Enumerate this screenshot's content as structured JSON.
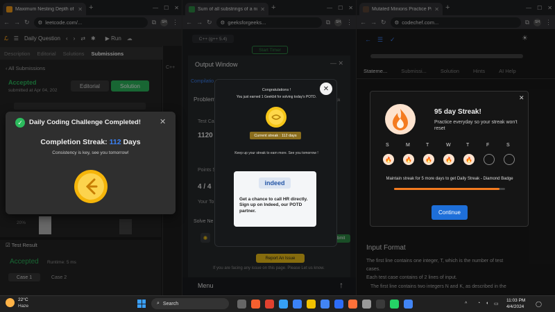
{
  "windows": {
    "leetcode": {
      "tab_title": "Maximum Nesting Depth of the",
      "url": "leetcode.com/...",
      "toolbar": {
        "title": "Daily Question",
        "run": "Run"
      },
      "tabs": [
        "Description",
        "Editorial",
        "Solutions",
        "Submissions"
      ],
      "all_submissions": "All Submissions",
      "status": "Accepted",
      "submitted": "submitted at Apr 04, 202",
      "editorial_btn": "Editorial",
      "solution_btn": "Solution",
      "pct": "20%",
      "test_result": "Test Result",
      "result_status": "Accepted",
      "runtime": "Runtime: 5 ms",
      "cases": [
        "Case 1",
        "Case 2"
      ],
      "modal": {
        "title": "Daily Coding Challenge Completed!",
        "streak_prefix": "Completion Streak:",
        "streak_value": "112",
        "streak_suffix": "Days",
        "subtitle": "Consistency is key, see you tomorrow!"
      }
    },
    "gfg": {
      "tab_title": "Sum of all substrings of a num",
      "url": "geeksforgeeks...",
      "lang": "C++ (g++ 5.4)",
      "start_timer": "Start Timer",
      "output_window": "Output Window",
      "compilation": "Compilatio",
      "problem": "Problem",
      "feedback": "edback",
      "test_cases": "Test Ca",
      "score1": "1120",
      "points": "Points S",
      "score2": "4 / 4",
      "your_total": "Your To",
      "solve_next": "Solve Ne",
      "submit": "Submit",
      "report": "Report An Issue",
      "report_note": "If you are facing any issue on this page. Please Let us know.",
      "menu": "Menu",
      "modal": {
        "congrats": "Congratulations !",
        "earned": "You just earned 1 Geekbit for solving today's POTD.",
        "current_streak": "Current streak : 112 days",
        "keep_up": "Keep up your streak to earn more. See you tomorrow !",
        "ad_brand": "indeed",
        "ad_text": "Get a chance to call HR directly. Sign up on Indeed, our POTD partner."
      }
    },
    "codechef": {
      "tab_title": "Mutated Minions Practice Probl",
      "url": "codechef.com...",
      "tabs": [
        "Stateme...",
        "Submissi...",
        "Solution",
        "Hints",
        "AI Help"
      ],
      "input_format_title": "Input Format",
      "input_lines": [
        "The first line contains one integer, T, which is the number of test",
        "cases.",
        "Each test case contains of 2 lines of input.",
        "The first line contains two integers N and K, as described in the"
      ],
      "modal": {
        "title": "95 day Streak!",
        "subtitle": "Practice everyday so your streak won't reset",
        "days": [
          "S",
          "M",
          "T",
          "W",
          "T",
          "F",
          "S"
        ],
        "days_done": [
          true,
          true,
          true,
          true,
          true,
          false,
          false
        ],
        "note": "Maintain streak for 5 more days to get Daily Streak - Diamond Badge",
        "progress": 0.95,
        "continue": "Continue"
      }
    }
  },
  "taskbar": {
    "weather_temp": "22°C",
    "weather_desc": "Haze",
    "search": "Search",
    "lang": "ENG IN",
    "time": "11:03 PM",
    "date": "4/4/2024"
  },
  "colors": {
    "leetcode_accent": "#2cbb5d",
    "leetcode_blue": "#3b82f6",
    "gfg_gold": "#f5c518",
    "codechef_blue": "#1e6fd9",
    "codechef_orange": "#f47b20"
  }
}
